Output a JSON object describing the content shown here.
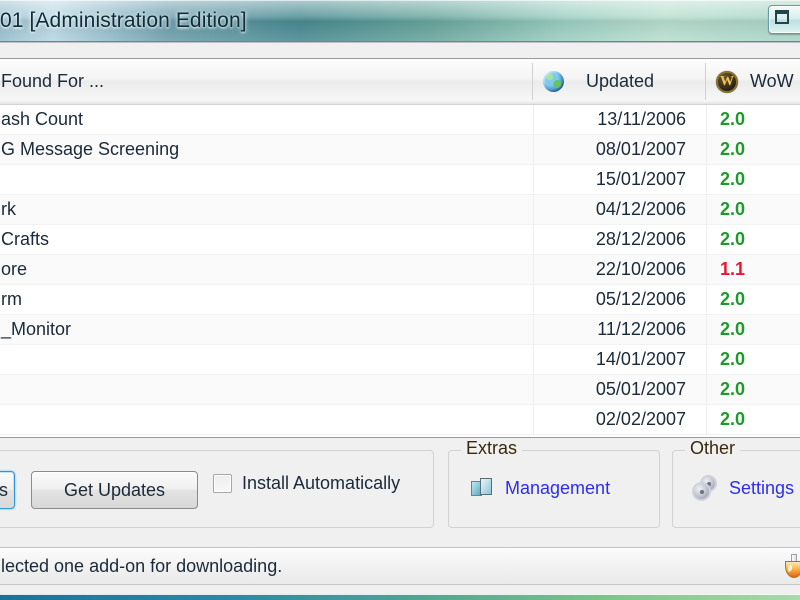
{
  "window": {
    "title": "01 [Administration Edition]",
    "control_button": "restore-down",
    "accent_color": "#4a8b92"
  },
  "listview": {
    "columns": [
      {
        "id": "name",
        "label": "Found For ...",
        "icon": ""
      },
      {
        "id": "updated",
        "label": "Updated",
        "icon": "globe-icon"
      },
      {
        "id": "version",
        "label": "WoW",
        "icon": "wow-icon"
      }
    ],
    "rows": [
      {
        "name": "ash Count",
        "updated": "13/11/2006",
        "version": "2.0",
        "version_state": "ok"
      },
      {
        "name": "G Message Screening",
        "updated": "08/01/2007",
        "version": "2.0",
        "version_state": "ok"
      },
      {
        "name": "",
        "updated": "15/01/2007",
        "version": "2.0",
        "version_state": "ok"
      },
      {
        "name": "rk",
        "updated": "04/12/2006",
        "version": "2.0",
        "version_state": "ok"
      },
      {
        "name": "Crafts",
        "updated": "28/12/2006",
        "version": "2.0",
        "version_state": "ok"
      },
      {
        "name": "ore",
        "updated": "22/10/2006",
        "version": "1.1",
        "version_state": "old"
      },
      {
        "name": "rm",
        "updated": "05/12/2006",
        "version": "2.0",
        "version_state": "ok"
      },
      {
        "name": "_Monitor",
        "updated": "11/12/2006",
        "version": "2.0",
        "version_state": "ok"
      },
      {
        "name": "",
        "updated": "14/01/2007",
        "version": "2.0",
        "version_state": "ok"
      },
      {
        "name": "",
        "updated": "05/01/2007",
        "version": "2.0",
        "version_state": "ok"
      },
      {
        "name": "",
        "updated": "02/02/2007",
        "version": "2.0",
        "version_state": "ok"
      }
    ]
  },
  "toolbar": {
    "actions": {
      "primary_button_label": "es",
      "get_updates_label": "Get Updates",
      "install_automatically_label": "Install Automatically",
      "install_automatically_checked": false
    },
    "extras": {
      "title": "Extras",
      "link_label": "Management",
      "link_icon": "package-cubes-icon",
      "link_color": "#2d2df0"
    },
    "other": {
      "title": "Other",
      "link_label": "Settings",
      "link_icon": "gears-icon",
      "link_color": "#2d2df0"
    }
  },
  "statusbar": {
    "message": "lected one add-on for downloading.",
    "right_icon": "flask-icon"
  }
}
